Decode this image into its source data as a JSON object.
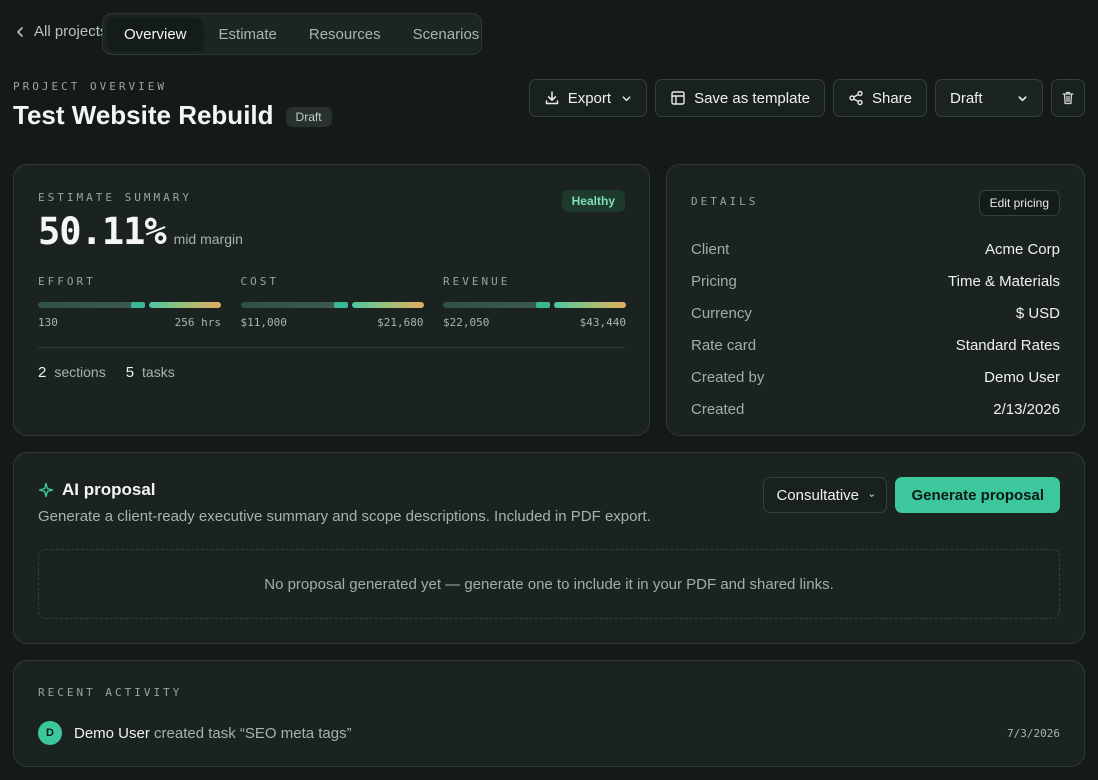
{
  "nav": {
    "back_label": "All projects",
    "tabs": [
      {
        "label": "Overview",
        "active": true
      },
      {
        "label": "Estimate",
        "active": false
      },
      {
        "label": "Resources",
        "active": false
      },
      {
        "label": "Scenarios",
        "active": false
      }
    ]
  },
  "header": {
    "eyebrow": "PROJECT OVERVIEW",
    "title": "Test Website Rebuild",
    "status_badge": "Draft",
    "actions": {
      "export_label": "Export",
      "template_label": "Save as template",
      "share_label": "Share",
      "status_select_value": "Draft"
    }
  },
  "summary": {
    "label": "ESTIMATE SUMMARY",
    "health": "Healthy",
    "margin_value": "50.11%",
    "margin_label": "mid margin",
    "metrics": [
      {
        "label": "EFFORT",
        "low": "130",
        "high": "256 hrs"
      },
      {
        "label": "COST",
        "low": "$11,000",
        "high": "$21,680"
      },
      {
        "label": "REVENUE",
        "low": "$22,050",
        "high": "$43,440"
      }
    ],
    "sections_count": "2",
    "sections_label": "sections",
    "tasks_count": "5",
    "tasks_label": "tasks"
  },
  "details": {
    "label": "DETAILS",
    "edit_label": "Edit pricing",
    "rows": [
      {
        "key": "Client",
        "value": "Acme Corp"
      },
      {
        "key": "Pricing",
        "value": "Time & Materials"
      },
      {
        "key": "Currency",
        "value": "$ USD"
      },
      {
        "key": "Rate card",
        "value": "Standard Rates"
      },
      {
        "key": "Created by",
        "value": "Demo User"
      },
      {
        "key": "Created",
        "value": "2/13/2026"
      }
    ]
  },
  "proposal": {
    "title": "AI proposal",
    "description": "Generate a client-ready executive summary and scope descriptions. Included in PDF export.",
    "tone_value": "Consultative",
    "generate_label": "Generate proposal",
    "empty_text": "No proposal generated yet — generate one to include it in your PDF and shared links."
  },
  "activity": {
    "label": "RECENT ACTIVITY",
    "items": [
      {
        "avatar": "D",
        "user": "Demo User",
        "action": "created task “SEO meta tags”",
        "date": "7/3/2026"
      }
    ]
  },
  "colors": {
    "accent": "#3dc79d",
    "background": "#141b17",
    "card": "#1a2320",
    "healthy_text": "#7fe0b2"
  }
}
